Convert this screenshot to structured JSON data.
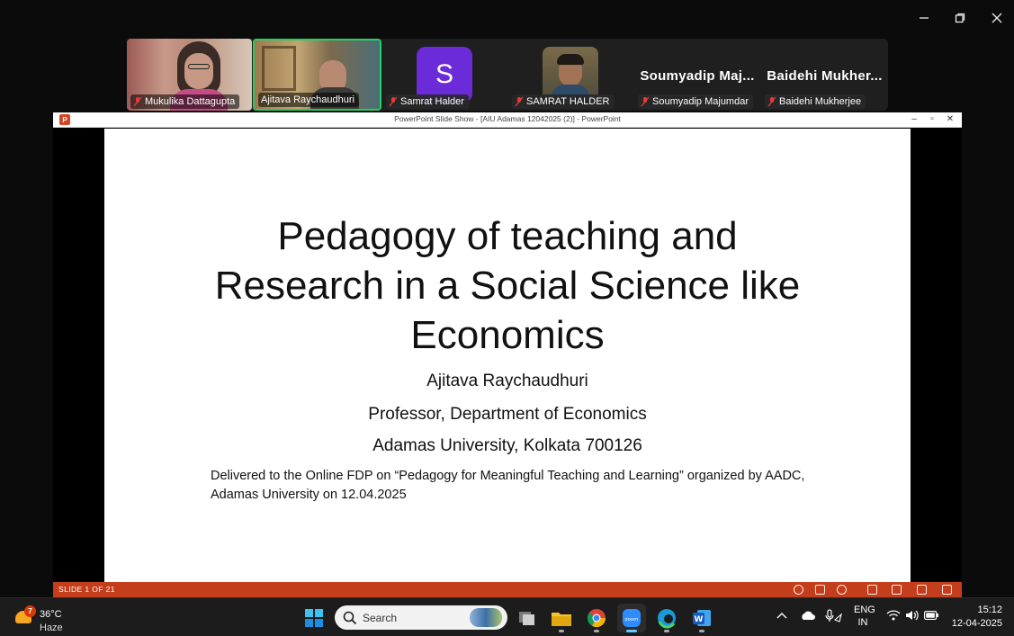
{
  "window_controls": {
    "minimize": "minimize",
    "restore": "restore",
    "close": "close"
  },
  "participants": [
    {
      "name": "Mukulika Dattagupta",
      "muted": true
    },
    {
      "name": "Ajitava Raychaudhuri",
      "muted": false,
      "active_speaker": true
    },
    {
      "name": "Samrat Halder",
      "muted": true,
      "avatar_letter": "S",
      "avatar_color": "#6c2bd9"
    },
    {
      "name": "SAMRAT HALDER",
      "muted": true
    },
    {
      "name": "Soumyadip Majumdar",
      "display": "Soumyadip  Maj...",
      "muted": true
    },
    {
      "name": "Baidehi Mukherjee",
      "display": "Baidehi  Mukher...",
      "muted": true
    }
  ],
  "ppt": {
    "window_title": "PowerPoint Slide Show - [AIU Adamas 12042025 (2)] - PowerPoint",
    "status": "SLIDE 1 OF 21",
    "accent": "#c43e1c"
  },
  "slide": {
    "title_line1": "Pedagogy of teaching and",
    "title_line2": "Research in a Social Science like",
    "title_line3": "Economics",
    "author": "Ajitava Raychaudhuri",
    "designation": "Professor, Department of Economics",
    "affiliation": "Adamas University, Kolkata 700126",
    "note": "Delivered to the Online FDP on “Pedagogy for Meaningful Teaching and Learning”  organized by AADC, Adamas University on 12.04.2025"
  },
  "taskbar": {
    "weather_temp": "36°C",
    "weather_cond": "Haze",
    "weather_badge": "7",
    "search_label": "Search",
    "apps": [
      "windows-start",
      "file-explorer",
      "task-view",
      "chrome",
      "zoom",
      "edge",
      "word"
    ],
    "lang_line1": "ENG",
    "lang_line2": "IN",
    "time": "15:12",
    "date": "12-04-2025"
  }
}
